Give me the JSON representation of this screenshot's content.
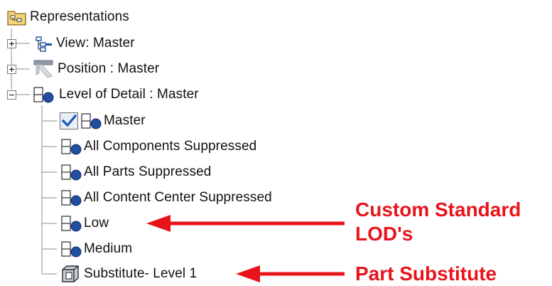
{
  "tree": {
    "root": {
      "label": "Representations",
      "icon": "representations-folder-icon"
    },
    "view": {
      "label": "View: Master",
      "icon": "design-view-icon",
      "expander": "plus"
    },
    "position": {
      "label": "Position : Master",
      "icon": "position-icon",
      "expander": "plus"
    },
    "lod": {
      "label": "Level of Detail : Master",
      "icon": "level-of-detail-icon",
      "expander": "minus"
    },
    "lod_children": [
      {
        "label": "Master",
        "icon": "level-of-detail-icon",
        "checked": true
      },
      {
        "label": "All Components Suppressed",
        "icon": "level-of-detail-icon"
      },
      {
        "label": "All Parts Suppressed",
        "icon": "level-of-detail-icon"
      },
      {
        "label": "All Content Center Suppressed",
        "icon": "level-of-detail-icon"
      },
      {
        "label": "Low",
        "icon": "level-of-detail-icon"
      },
      {
        "label": "Medium",
        "icon": "level-of-detail-icon"
      },
      {
        "label": "Substitute- Level 1",
        "icon": "substitute-part-icon"
      }
    ]
  },
  "annotations": {
    "custom_line1": "Custom Standard",
    "custom_line2": "LOD's",
    "part_substitute": "Part Substitute",
    "color": "#e8141c"
  },
  "colors": {
    "icon_blue": "#1f4f9e",
    "icon_outline": "#3b3b3b",
    "connector": "#9a9a9a",
    "check_blue": "#1a56b8"
  }
}
